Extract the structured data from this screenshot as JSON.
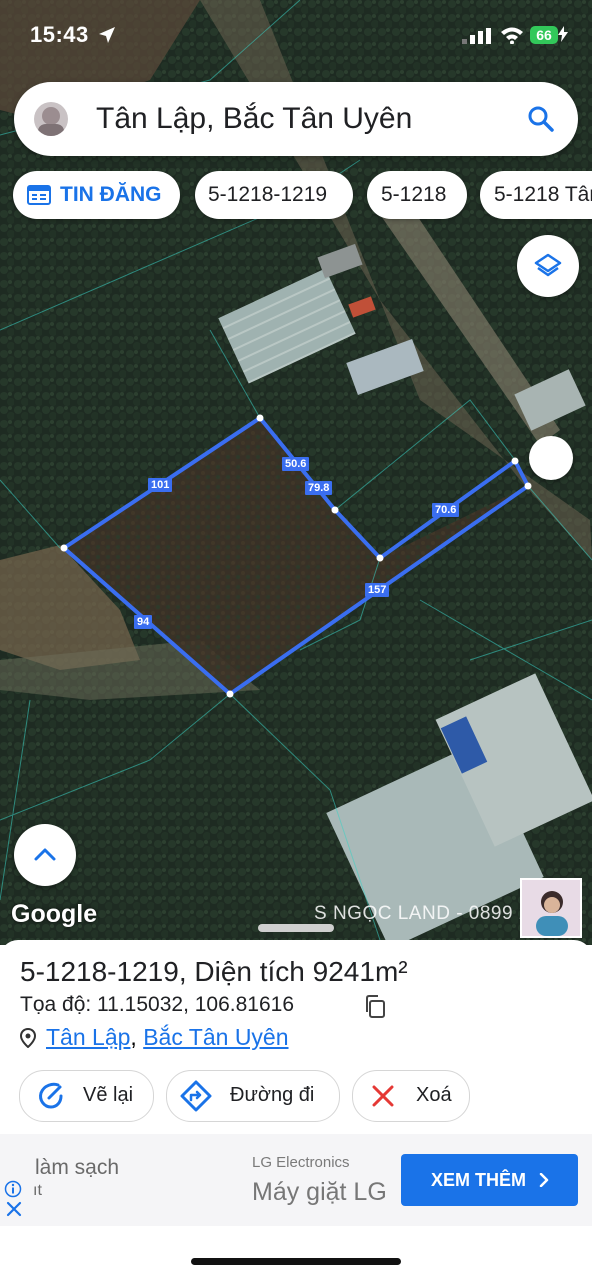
{
  "status_bar": {
    "time": "15:43",
    "battery": "66"
  },
  "search": {
    "query": "Tân Lập, Bắc Tân Uyên"
  },
  "chips": [
    {
      "label": "TIN ĐĂNG",
      "icon": "listing-icon"
    },
    {
      "label": "5-1218-1219"
    },
    {
      "label": "5-1218"
    },
    {
      "label": "5-1218 Tân"
    }
  ],
  "map": {
    "edge_labels": [
      "101",
      "50.6",
      "79.8",
      "70.6",
      "157",
      "94"
    ],
    "attribution": "Google",
    "watermark": "S NGỌC LAND - 0899 2030",
    "parcel_color": "#3a6ef0"
  },
  "detail": {
    "parcel_id": "5-1218-1219",
    "area_prefix": ", Diện tích ",
    "area_value": "9241m²",
    "coords_label": "Tọa độ: 11.15032, 106.81616",
    "commune": "Tân Lập",
    "separator": ", ",
    "district": "Bắc Tân Uyên"
  },
  "actions": [
    {
      "label": "Vẽ lại",
      "icon": "redraw-icon"
    },
    {
      "label": "Đường đi",
      "icon": "directions-icon"
    },
    {
      "label": "Xoá",
      "icon": "delete-icon"
    }
  ],
  "ad": {
    "line1": "làm sạch",
    "line2": "ıt",
    "brand": "LG Electronics",
    "product": "Máy giặt LG",
    "cta": "XEM THÊM"
  },
  "colors": {
    "accent": "#1a73e8",
    "delete": "#e53935"
  }
}
